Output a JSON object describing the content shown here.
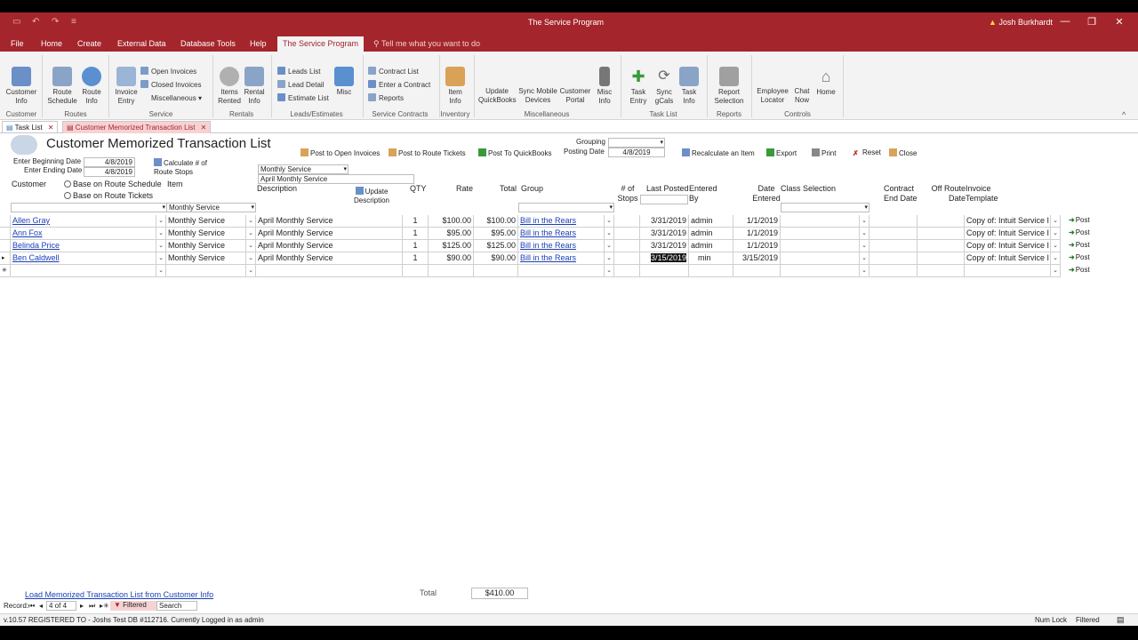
{
  "window": {
    "title": "The Service Program",
    "user": "Josh Burkhardt"
  },
  "ribbon_tabs": [
    "File",
    "Home",
    "Create",
    "External Data",
    "Database Tools",
    "Help",
    "The Service Program"
  ],
  "tell_me": "Tell me what you want to do",
  "ribbon": {
    "customer_info": "Customer Info",
    "route_schedule": "Route Schedule",
    "route_info": "Route Info",
    "invoice_entry": "Invoice Entry",
    "open_invoices": "Open Invoices",
    "closed_invoices": "Closed Invoices",
    "miscellaneous": "Miscellaneous",
    "items_rented": "Items Rented",
    "rental_info": "Rental Info",
    "leads_list": "Leads List",
    "lead_detail": "Lead Detail",
    "estimate_list": "Estimate List",
    "misc": "Misc",
    "contract_list": "Contract List",
    "enter_contract": "Enter a Contract",
    "reports_small": "Reports",
    "item_info": "Item Info",
    "update_qb": "Update QuickBooks",
    "sync_mobile": "Sync Mobile Devices",
    "customer_portal": "Customer Portal",
    "misc_info": "Misc Info",
    "task_entry": "Task Entry",
    "sync_gcals": "Sync gCals",
    "task_info": "Task Info",
    "report_selection": "Report Selection",
    "employee_locator": "Employee Locator",
    "chat_now": "Chat Now",
    "home": "Home",
    "groups": {
      "customer": "Customer",
      "routes": "Routes",
      "service": "Service",
      "rentals": "Rentals",
      "leads": "Leads/Estimates",
      "contracts": "Service Contracts",
      "inventory": "Inventory",
      "miscellaneous": "Miscellaneous",
      "tasklist": "Task List",
      "reports": "Reports",
      "controls": "Controls"
    }
  },
  "doc_tabs": [
    "Task List",
    "Customer Memorized Transaction List"
  ],
  "form": {
    "title": "Customer Memorized Transaction List",
    "enter_beginning_date_label": "Enter Beginning Date",
    "enter_beginning_date": "4/8/2019",
    "enter_ending_date_label": "Enter Ending Date",
    "enter_ending_date": "4/8/2019",
    "calc_stops": "Calculate # of Route Stops",
    "item_filter": "Monthly Service",
    "description_filter": "April Monthly Service",
    "post_open_invoices": "Post to Open Invoices",
    "post_route_tickets": "Post to Route Tickets",
    "post_qb": "Post To QuickBooks",
    "grouping_label": "Grouping",
    "posting_date_label": "Posting Date",
    "posting_date": "4/8/2019",
    "recalculate": "Recalculate an Item",
    "export": "Export",
    "print": "Print",
    "reset": "Reset",
    "close": "Close",
    "customer_label": "Customer",
    "base_route_schedule": "Base on Route Schedule",
    "base_route_tickets": "Base on Route Tickets",
    "item_label": "Item",
    "update_description": "Update Description"
  },
  "columns": {
    "description": "Description",
    "qty": "QTY",
    "rate": "Rate",
    "total": "Total",
    "group": "Group",
    "stops": "# of Stops",
    "last_posted": "Last Posted",
    "entered_by": "Entered By",
    "date_entered": "Date Entered",
    "class_selection": "Class Selection",
    "contract_end": "Contract End Date",
    "off_route": "Off Route Date",
    "invoice_template": "Invoice Template"
  },
  "filter_row": {
    "item": "Monthly Service"
  },
  "rows": [
    {
      "customer": "Allen Gray",
      "item": "Monthly Service",
      "description": "April Monthly Service",
      "qty": "1",
      "rate": "$100.00",
      "total": "$100.00",
      "group": "Bill in the Rears",
      "last_posted": "3/31/2019",
      "entered_by": "admin",
      "date_entered": "1/1/2019",
      "template": "Copy of: Intuit Service I",
      "post": "Post"
    },
    {
      "customer": "Ann Fox",
      "item": "Monthly Service",
      "description": "April Monthly Service",
      "qty": "1",
      "rate": "$95.00",
      "total": "$95.00",
      "group": "Bill in the Rears",
      "last_posted": "3/31/2019",
      "entered_by": "admin",
      "date_entered": "1/1/2019",
      "template": "Copy of: Intuit Service I",
      "post": "Post"
    },
    {
      "customer": "Belinda Price",
      "item": "Monthly Service",
      "description": "April Monthly Service",
      "qty": "1",
      "rate": "$125.00",
      "total": "$125.00",
      "group": "Bill in the Rears",
      "last_posted": "3/31/2019",
      "entered_by": "admin",
      "date_entered": "1/1/2019",
      "template": "Copy of: Intuit Service I",
      "post": "Post"
    },
    {
      "customer": "Ben Caldwell",
      "item": "Monthly Service",
      "description": "April Monthly Service",
      "qty": "1",
      "rate": "$90.00",
      "total": "$90.00",
      "group": "Bill in the Rears",
      "last_posted": "3/15/2019",
      "entered_by": "min",
      "date_entered": "3/15/2019",
      "template": "Copy of: Intuit Service I",
      "post": "Post"
    }
  ],
  "new_row_post": "Post",
  "footer": {
    "load_link": "Load Memorized Transaction List from Customer Info",
    "total_label": "Total",
    "total_value": "$410.00"
  },
  "record_nav": {
    "label": "Record:",
    "position": "4 of 4",
    "filtered": "Filtered",
    "search": "Search"
  },
  "status": {
    "left": "v.10.57 REGISTERED TO - Joshs Test DB #112716. Currently Logged in as admin",
    "num_lock": "Num Lock",
    "filtered": "Filtered"
  }
}
